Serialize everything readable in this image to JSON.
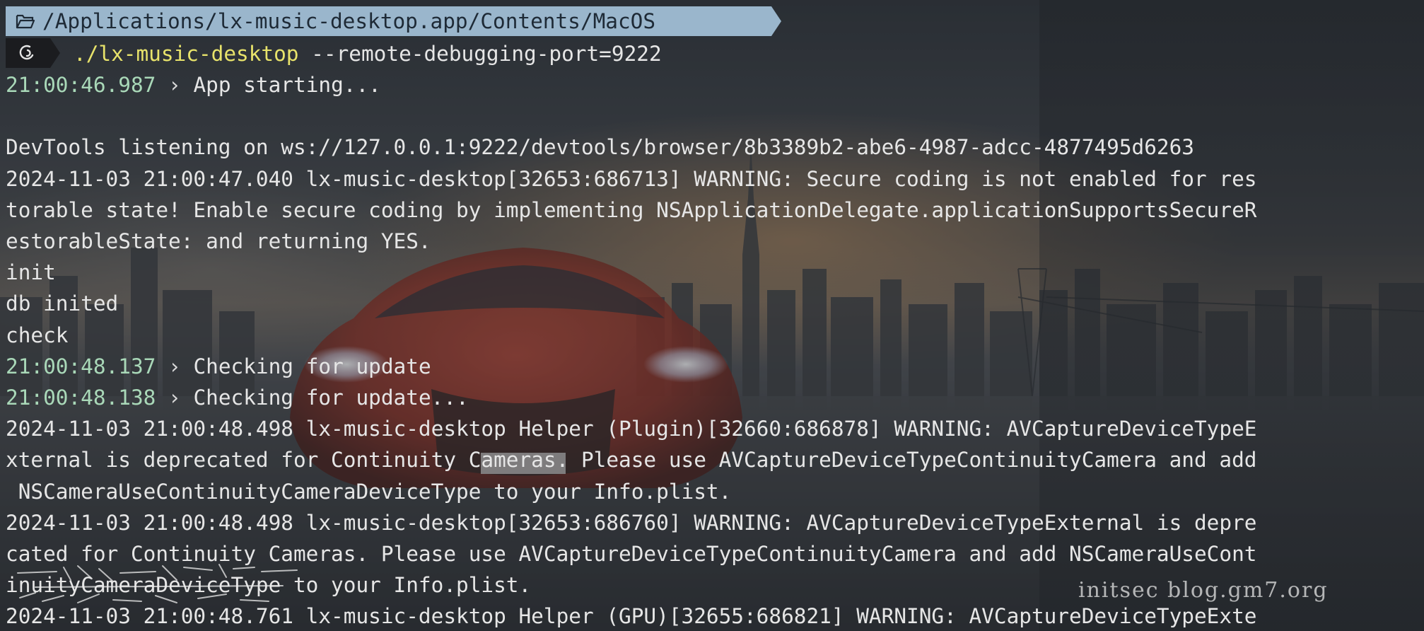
{
  "prompt": {
    "path": "/Applications/lx-music-desktop.app/Contents/MacOS",
    "command": "./lx-music-desktop",
    "args": " --remote-debugging-port=9222",
    "folder_icon": "folder-open-icon",
    "badge_icon": "debian-swirl-icon"
  },
  "log": [
    {
      "ts": "21:00:46.987",
      "sep": " › ",
      "msg": "App starting..."
    },
    {
      "msg": ""
    },
    {
      "msg": "DevTools listening on ws://127.0.0.1:9222/devtools/browser/8b3389b2-abe6-4987-adcc-4877495d6263"
    },
    {
      "msg": "2024-11-03 21:00:47.040 lx-music-desktop[32653:686713] WARNING: Secure coding is not enabled for res"
    },
    {
      "msg": "torable state! Enable secure coding by implementing NSApplicationDelegate.applicationSupportsSecureR"
    },
    {
      "msg": "estorableState: and returning YES."
    },
    {
      "msg": "init"
    },
    {
      "msg": "db inited"
    },
    {
      "msg": "check"
    },
    {
      "ts": "21:00:48.137",
      "sep": " › ",
      "msg": "Checking for update"
    },
    {
      "ts": "21:00:48.138",
      "sep": " › ",
      "msg": "Checking for update..."
    },
    {
      "msg": "2024-11-03 21:00:48.498 lx-music-desktop Helper (Plugin)[32660:686878] WARNING: AVCaptureDeviceTypeE"
    },
    {
      "msg": "xternal is deprecated for Continuity Cameras. Please use AVCaptureDeviceTypeContinuityCamera and add"
    },
    {
      "msg": " NSCameraUseContinuityCameraDeviceType to your Info.plist."
    },
    {
      "msg": "2024-11-03 21:00:48.498 lx-music-desktop[32653:686760] WARNING: AVCaptureDeviceTypeExternal is depre"
    },
    {
      "msg": "cated for Continuity Cameras. Please use AVCaptureDeviceTypeContinuityCamera and add NSCameraUseCont"
    },
    {
      "msg": "inuityCameraDeviceType to your Info.plist."
    },
    {
      "msg": "2024-11-03 21:00:48.761 lx-music-desktop Helper (GPU)[32655:686821] WARNING: AVCaptureDeviceTypeExte"
    }
  ],
  "watermark": "initsec blog.gm7.org",
  "colors": {
    "prompt_path_bg": "#9ab6cc",
    "prompt_badge_bg": "#1b1c1f",
    "command": "#e8e36b",
    "timestamp": "#a9d8b8",
    "text": "#e6e6e6"
  }
}
